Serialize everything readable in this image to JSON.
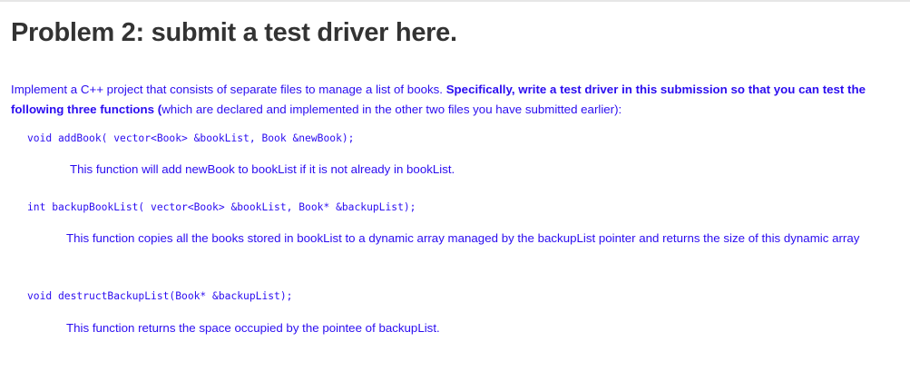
{
  "title": "Problem 2: submit a test driver here.",
  "intro": {
    "p1": "Implement a C++ project that consists of separate files to manage a list of books. ",
    "p2": "Specifically, write a test driver in this submission so that you can test the following three functions (",
    "p3": "which are declared and implemented in the other two files you have submitted earlier):"
  },
  "functions": [
    {
      "signature": "void addBook( vector<Book> &bookList, Book &newBook);",
      "description": "This function will add newBook to bookList if it is not already in bookList."
    },
    {
      "signature": "int backupBookList( vector<Book> &bookList, Book* &backupList);",
      "description": "This function copies all the books stored in bookList to a dynamic array managed by the backupList pointer and returns the size of this dynamic array"
    },
    {
      "signature": "void destructBackupList(Book* &backupList);",
      "description": "This function returns the space occupied by the pointee of backupList."
    }
  ]
}
